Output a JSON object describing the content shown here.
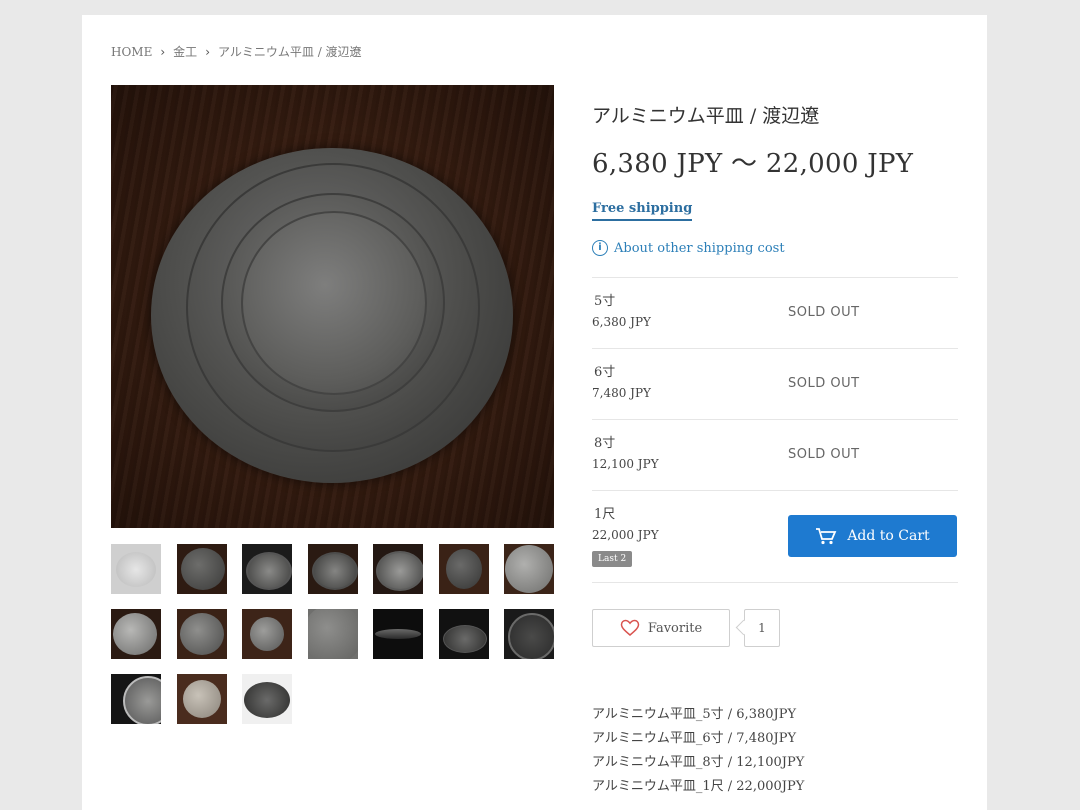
{
  "breadcrumb": {
    "home": "HOME",
    "category": "金工",
    "current": "アルミニウム平皿 / 渡辺遼"
  },
  "product": {
    "title": "アルミニウム平皿 / 渡辺遼",
    "price_range": "6,380 JPY 〜 22,000 JPY",
    "free_shipping": "Free shipping",
    "shipping_link": "About other shipping cost"
  },
  "variants": [
    {
      "name": "5寸",
      "price": "6,380 JPY",
      "status": "SOLD OUT"
    },
    {
      "name": "6寸",
      "price": "7,480 JPY",
      "status": "SOLD OUT"
    },
    {
      "name": "8寸",
      "price": "12,100 JPY",
      "status": "SOLD OUT"
    },
    {
      "name": "1尺",
      "price": "22,000 JPY",
      "badge": "Last 2",
      "cart_label": "Add to Cart"
    }
  ],
  "favorite": {
    "label": "Favorite",
    "count": "1"
  },
  "description": [
    "アルミニウム平皿_5寸 / 6,380JPY",
    "アルミニウム平皿_6寸 / 7,480JPY",
    "アルミニウム平皿_8寸 / 12,100JPY",
    "アルミニウム平皿_1尺 / 22,000JPY"
  ],
  "colors": {
    "accent_blue": "#1e7ad0",
    "link_blue": "#2c7fb8",
    "badge_gray": "#8a8a8a"
  }
}
